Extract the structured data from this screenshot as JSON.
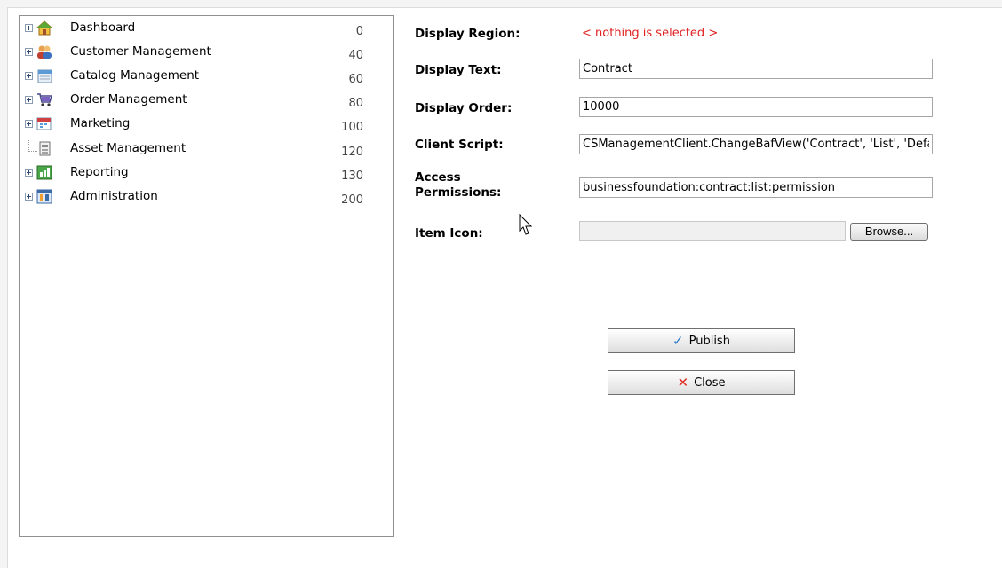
{
  "tree": {
    "items": [
      {
        "label": "Dashboard",
        "order": "0",
        "icon": "home-icon",
        "expandable": true
      },
      {
        "label": "Customer Management",
        "order": "40",
        "icon": "users-icon",
        "expandable": true
      },
      {
        "label": "Catalog Management",
        "order": "60",
        "icon": "catalog-icon",
        "expandable": true
      },
      {
        "label": "Order Management",
        "order": "80",
        "icon": "cart-icon",
        "expandable": true
      },
      {
        "label": "Marketing",
        "order": "100",
        "icon": "calendar-icon",
        "expandable": true
      },
      {
        "label": "Asset Management",
        "order": "120",
        "icon": "document-icon",
        "expandable": false
      },
      {
        "label": "Reporting",
        "order": "130",
        "icon": "chart-icon",
        "expandable": true
      },
      {
        "label": "Administration",
        "order": "200",
        "icon": "admin-icon",
        "expandable": true
      }
    ]
  },
  "form": {
    "display_region_label": "Display Region:",
    "display_region_value": "< nothing is selected >",
    "display_text_label": "Display Text:",
    "display_text_value": "Contract",
    "display_order_label": "Display Order:",
    "display_order_value": "10000",
    "client_script_label": "Client Script:",
    "client_script_value": "CSManagementClient.ChangeBafView('Contract', 'List', 'Default')",
    "access_permissions_label_1": "Access",
    "access_permissions_label_2": "Permissions:",
    "access_permissions_value": "businessfoundation:contract:list:permission",
    "item_icon_label": "Item Icon:",
    "browse_label": "Browse..."
  },
  "actions": {
    "publish_label": "Publish",
    "close_label": "Close"
  },
  "colors": {
    "nothing_selected": "#e02020",
    "publish_check": "#2a78c8",
    "close_x": "#e0281e"
  }
}
